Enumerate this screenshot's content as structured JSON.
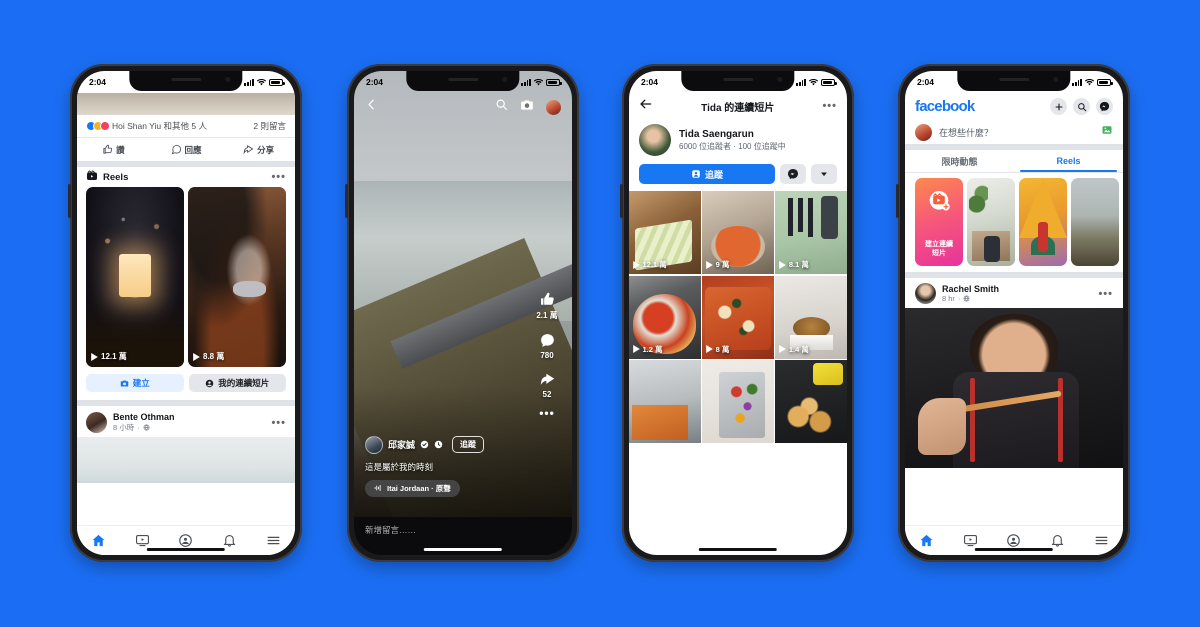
{
  "background_color": "#1b6ef3",
  "phones": [
    {
      "id": "phone-feed",
      "status": {
        "time": "2:04"
      },
      "post_engagement": {
        "reactions_text": "Hoi Shan Yiu 和其他 5 人",
        "comments_text": "2 則留言",
        "actions": [
          {
            "icon": "thumbs-up-icon",
            "label": "讚"
          },
          {
            "icon": "comment-icon",
            "label": "回應"
          },
          {
            "icon": "share-icon",
            "label": "分享"
          }
        ]
      },
      "reels_unit": {
        "icon": "reels-icon",
        "title": "Reels",
        "menu_icon": "ellipsis-icon",
        "thumbnails": [
          {
            "views": "12.1 萬"
          },
          {
            "views": "8.8 萬"
          }
        ],
        "ctas": [
          {
            "icon": "camera-icon",
            "label": "建立",
            "style": "blue"
          },
          {
            "icon": "person-icon",
            "label": "我的連續短片",
            "style": "gray"
          }
        ]
      },
      "next_post": {
        "name": "Bente Othman",
        "time": "8 小時",
        "privacy": "globe-icon"
      },
      "tabbar": [
        "home-icon",
        "video-icon",
        "groups-icon",
        "bell-icon",
        "menu-icon"
      ],
      "active_tab_index": 0
    },
    {
      "id": "phone-reel-player",
      "status": {
        "time": "2:04"
      },
      "topbar": [
        "back-arrow-icon",
        "search-icon",
        "camera-icon",
        "avatar"
      ],
      "side_actions": [
        {
          "icon": "thumbs-up-icon",
          "count": "2.1 萬"
        },
        {
          "icon": "comment-icon",
          "count": "780"
        },
        {
          "icon": "share-icon",
          "count": "52"
        },
        {
          "icon": "ellipsis-icon",
          "count": ""
        }
      ],
      "author": {
        "name": "邱家誠",
        "verified": "check-badge-icon",
        "clock": "clock-icon",
        "follow_label": "追蹤"
      },
      "caption": "這是屬於我的時刻",
      "music": {
        "icon": "audio-wave-icon",
        "label": "Itai Jordaan · 原聲"
      },
      "comment_placeholder": "新增留言……"
    },
    {
      "id": "phone-profile-reels",
      "status": {
        "time": "2:04"
      },
      "navbar": {
        "back": "back-arrow-icon",
        "title": "Tida 的連續短片",
        "menu": "ellipsis-icon"
      },
      "profile": {
        "name": "Tida Saengarun",
        "stats": "6000 位追蹤者  ·  100 位追蹤中",
        "follow_button": {
          "icon": "person-add-icon",
          "label": "追蹤"
        },
        "messenger_button": "messenger-icon",
        "more_button": "chevron-down-icon"
      },
      "grid": [
        {
          "views": "12.1 萬"
        },
        {
          "views": "9 萬"
        },
        {
          "views": "8.1 萬"
        },
        {
          "views": "1.2 萬"
        },
        {
          "views": "8 萬"
        },
        {
          "views": "1.4 萬"
        },
        {
          "views": ""
        },
        {
          "views": ""
        },
        {
          "views": ""
        }
      ]
    },
    {
      "id": "phone-fb-home",
      "status": {
        "time": "2:04"
      },
      "header": {
        "logo": "facebook",
        "actions": [
          "plus-icon",
          "search-icon",
          "messenger-icon"
        ]
      },
      "composer": {
        "placeholder": "在想些什麼？",
        "photo_icon": "photo-icon"
      },
      "tabs": [
        {
          "label": "限時動態",
          "active": false
        },
        {
          "label": "Reels",
          "active": true
        }
      ],
      "carousel": [
        {
          "type": "create",
          "icon": "reels-plus-icon",
          "label": "建立連續\n短片"
        },
        {
          "type": "thumb"
        },
        {
          "type": "thumb"
        },
        {
          "type": "thumb"
        }
      ],
      "post": {
        "name": "Rachel Smith",
        "time": "8 hr",
        "privacy": "globe-icon",
        "menu": "ellipsis-icon"
      },
      "tabbar": [
        "home-icon",
        "video-icon",
        "groups-icon",
        "bell-icon",
        "menu-icon"
      ],
      "active_tab_index": 0
    }
  ],
  "colors": {
    "fb_blue": "#1877f2",
    "background": "#1b6ef3",
    "light_gray": "#e4e6eb",
    "text_primary": "#14161a",
    "text_secondary": "#606770"
  }
}
